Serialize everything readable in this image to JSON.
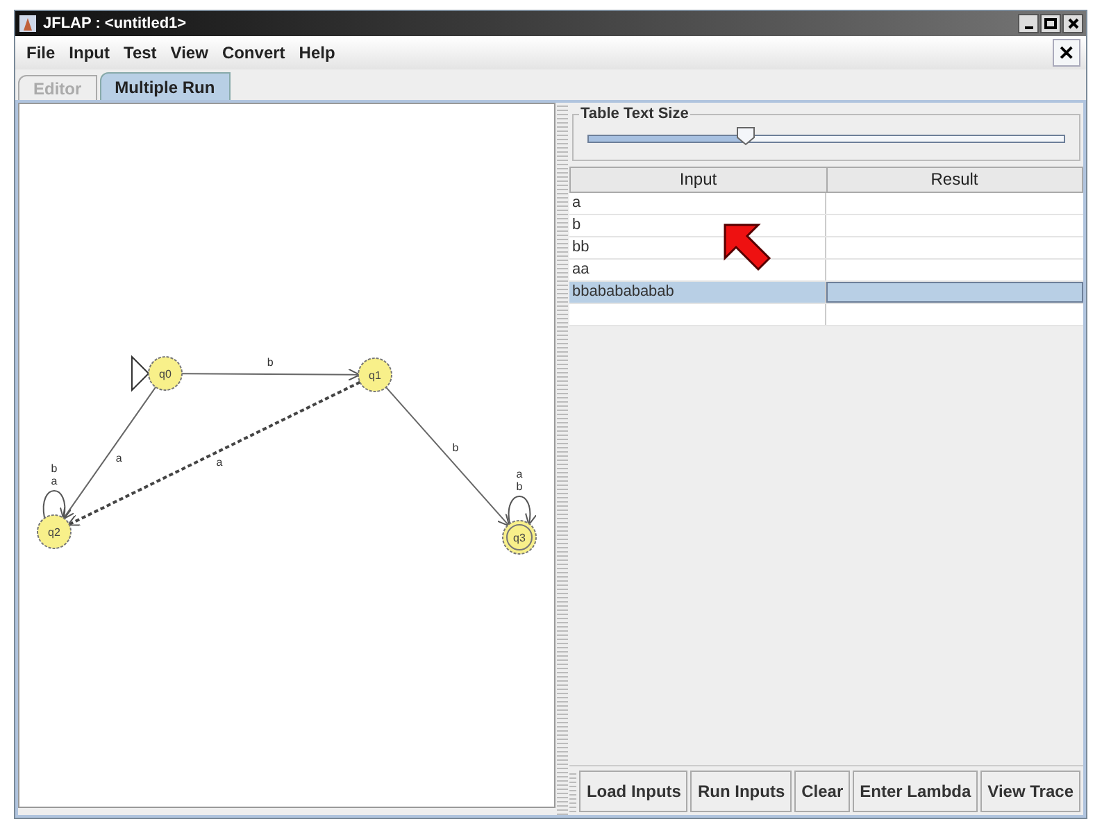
{
  "window": {
    "title": "JFLAP : <untitled1>"
  },
  "menu": [
    "File",
    "Input",
    "Test",
    "View",
    "Convert",
    "Help"
  ],
  "close_label": "✕",
  "tabs": [
    {
      "label": "Editor",
      "selected": false,
      "disabled": true
    },
    {
      "label": "Multiple Run",
      "selected": true,
      "disabled": false
    }
  ],
  "automaton": {
    "states": [
      {
        "name": "q0",
        "initial": true,
        "final": false
      },
      {
        "name": "q1",
        "initial": false,
        "final": false
      },
      {
        "name": "q2",
        "initial": false,
        "final": false
      },
      {
        "name": "q3",
        "initial": false,
        "final": true
      }
    ],
    "transitions": [
      {
        "label": "b",
        "highlighted": false
      },
      {
        "label": "a",
        "highlighted": false
      },
      {
        "label": "a",
        "highlighted": true
      },
      {
        "label": "b",
        "highlighted": false
      },
      {
        "labels": [
          "b",
          "a"
        ],
        "highlighted": false
      },
      {
        "labels": [
          "a",
          "b"
        ],
        "highlighted": false
      }
    ]
  },
  "text_size": {
    "title": "Table Text Size",
    "level": 0.33
  },
  "table": {
    "columns": [
      "Input",
      "Result"
    ],
    "rows": [
      {
        "input": "a",
        "selected": false
      },
      {
        "input": "b",
        "selected": false
      },
      {
        "input": "bb",
        "selected": false
      },
      {
        "input": "aa",
        "selected": false
      },
      {
        "input": "bbababababab",
        "selected": true
      }
    ]
  },
  "buttons": [
    "Load Inputs",
    "Run Inputs",
    "Clear",
    "Enter Lambda",
    "View Trace"
  ]
}
